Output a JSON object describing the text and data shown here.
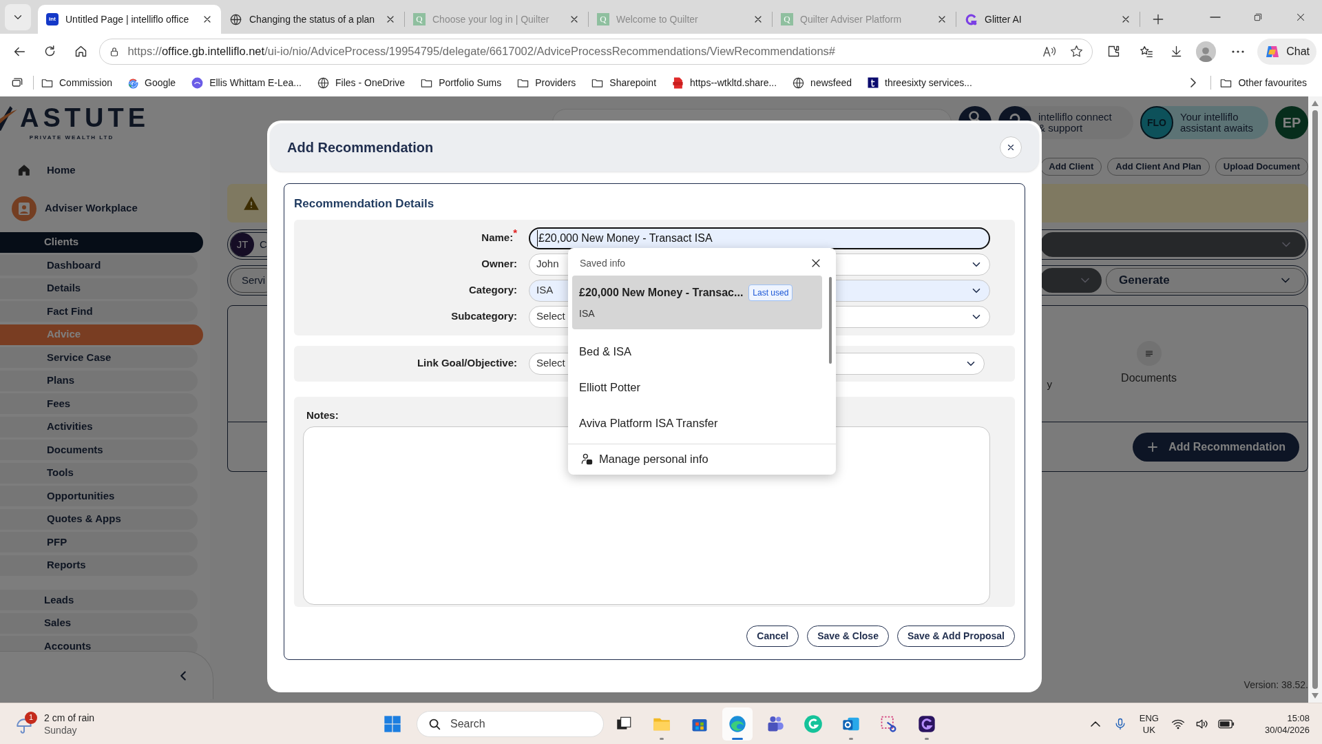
{
  "browser": {
    "tabs": [
      {
        "title": "Untitled Page | intelliflo office",
        "kind": "int",
        "icon_text": "int",
        "sleeping": false,
        "selected": true
      },
      {
        "title": "Changing the status of a plan",
        "kind": "globe",
        "sleeping": false,
        "selected": false
      },
      {
        "title": "Choose your log in | Quilter",
        "kind": "quilter",
        "icon_text": "Q",
        "sleeping": true,
        "selected": false
      },
      {
        "title": "Welcome to Quilter",
        "kind": "quilter",
        "icon_text": "Q",
        "sleeping": true,
        "selected": false
      },
      {
        "title": "Quilter Adviser Platform",
        "kind": "quilter",
        "icon_text": "Q",
        "sleeping": true,
        "selected": false
      },
      {
        "title": "Glitter AI",
        "kind": "glitter",
        "sleeping": false,
        "selected": false
      }
    ],
    "address": {
      "scheme": "https://",
      "host": "office.gb.intelliflo.net",
      "path": "/ui-io/nio/AdviceProcess/19954795/delegate/6617002/AdviceProcessRecommendations/ViewRecommendations#"
    },
    "chat_label": "Chat",
    "bookmarks": [
      {
        "label": "Commission",
        "kind": "folder"
      },
      {
        "label": "Google",
        "kind": "google"
      },
      {
        "label": "Ellis Whittam E-Lea...",
        "kind": "nest"
      },
      {
        "label": "Files - OneDrive",
        "kind": "globe"
      },
      {
        "label": "Portfolio Sums",
        "kind": "folder"
      },
      {
        "label": "Providers",
        "kind": "folder"
      },
      {
        "label": "Sharepoint",
        "kind": "folder"
      },
      {
        "label": "https--wtkltd.share...",
        "kind": "pdf"
      },
      {
        "label": "newsfeed",
        "kind": "globe"
      },
      {
        "label": "threesixty services...",
        "kind": "t"
      }
    ],
    "other_favourites": "Other favourites"
  },
  "page": {
    "logo": {
      "name": "ASTUTE",
      "tagline": "PRIVATE WEALTH LTD"
    },
    "home": "Home",
    "workplace": "Adviser Workplace",
    "nav": [
      {
        "label": "Clients",
        "kind": "group",
        "selected": true
      },
      {
        "label": "Dashboard",
        "kind": "sub",
        "selected": false
      },
      {
        "label": "Details",
        "kind": "sub",
        "selected": false
      },
      {
        "label": "Fact Find",
        "kind": "sub",
        "selected": false
      },
      {
        "label": "Advice",
        "kind": "sub",
        "selected": true
      },
      {
        "label": "Service Case",
        "kind": "sub",
        "selected": false
      },
      {
        "label": "Plans",
        "kind": "sub",
        "selected": false
      },
      {
        "label": "Fees",
        "kind": "sub",
        "selected": false
      },
      {
        "label": "Activities",
        "kind": "sub",
        "selected": false
      },
      {
        "label": "Documents",
        "kind": "sub",
        "selected": false
      },
      {
        "label": "Tools",
        "kind": "sub",
        "selected": false
      },
      {
        "label": "Opportunities",
        "kind": "sub",
        "selected": false
      },
      {
        "label": "Quotes & Apps",
        "kind": "sub",
        "selected": false
      },
      {
        "label": "PFP",
        "kind": "sub",
        "selected": false
      },
      {
        "label": "Reports",
        "kind": "sub",
        "selected": false
      },
      {
        "label": "Leads",
        "kind": "group",
        "selected": false
      },
      {
        "label": "Sales",
        "kind": "group",
        "selected": false
      },
      {
        "label": "Accounts",
        "kind": "group",
        "selected": false
      }
    ],
    "header": {
      "connect": "intelliflo connect & support",
      "flo_logo": "FLO",
      "flo_text": "Your intelliflo assistant awaits",
      "avatar": "EP"
    },
    "actions": [
      "Add Client",
      "Add Client And Plan",
      "Upload Document"
    ],
    "client": {
      "avatar": "JT",
      "name": "C"
    },
    "service_chip": "Servi",
    "generate": "Generate",
    "step_partial": "y",
    "step_documents": "Documents",
    "add_recommendation": "Add Recommendation",
    "version": "Version: 38.52."
  },
  "modal": {
    "title": "Add Recommendation",
    "section_title": "Recommendation Details",
    "fields": [
      {
        "label": "Name:$^{*}$",
        "kind": "text",
        "value": "£20,000 New Money - Transact ISA",
        "autofilled": true,
        "focused": true
      },
      {
        "label": "Owner:",
        "kind": "select",
        "value": "John",
        "autofilled": false,
        "focused": false
      },
      {
        "label": "Category:",
        "kind": "select",
        "value": "ISA",
        "autofilled": true,
        "focused": false
      },
      {
        "label": "Subcategory:",
        "kind": "select",
        "value": "Select",
        "autofilled": false,
        "focused": false
      }
    ],
    "goal": {
      "label": "Link Goal/Objective:",
      "value": "Select"
    },
    "notes_label": "Notes:",
    "buttons": [
      "Cancel",
      "Save & Close",
      "Save & Add Proposal"
    ]
  },
  "autofill": {
    "title": "Saved info",
    "items": [
      {
        "label": "£20,000 New Money - Transac...",
        "sub": "ISA",
        "badge": "Last used",
        "selected": true
      },
      {
        "label": "Bed & ISA",
        "selected": false
      },
      {
        "label": "Elliott Potter",
        "selected": false
      },
      {
        "label": "Aviva Platform ISA Transfer",
        "selected": false
      }
    ],
    "footer": "Manage personal info"
  },
  "taskbar": {
    "weather": {
      "badge": "1",
      "text": "2 cm of rain",
      "day": "Sunday"
    },
    "search": "Search",
    "apps": [
      {
        "kind": "taskview",
        "open": false,
        "selected": false
      },
      {
        "kind": "explorer",
        "open": true,
        "selected": false
      },
      {
        "kind": "store",
        "open": false,
        "selected": false
      },
      {
        "kind": "edge",
        "open": true,
        "selected": true
      },
      {
        "kind": "teams",
        "open": false,
        "selected": false
      },
      {
        "kind": "grammarly",
        "open": false,
        "selected": false
      },
      {
        "kind": "outlook",
        "open": true,
        "selected": false
      },
      {
        "kind": "snip",
        "open": false,
        "selected": false
      },
      {
        "kind": "glitter",
        "open": true,
        "selected": false
      }
    ],
    "lang": "ENG",
    "region": "UK",
    "time": "15:08",
    "date": "30/04/2026"
  }
}
